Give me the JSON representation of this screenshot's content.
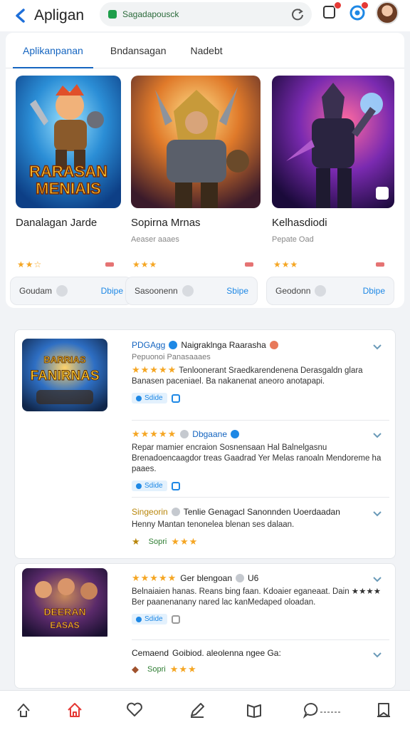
{
  "header": {
    "title": "Apligan",
    "url": "Sagadapousck"
  },
  "tabs": [
    {
      "label": "Aplikanpanan"
    },
    {
      "label": "Bndansagan"
    },
    {
      "label": "Nadebt"
    }
  ],
  "cards": [
    {
      "title": "Danalagan Jarde",
      "subtitle": "",
      "art_text_1": "RARASAN",
      "art_text_2": "MENIAIS",
      "stars": "★★☆",
      "foot_left": "Goudam",
      "foot_right": "Dbipe"
    },
    {
      "title": "Sopirna Mrnas",
      "subtitle": "Aeaser aaaes",
      "stars": "★★★",
      "foot_left": "Sasoonenn",
      "foot_right": "Sbipe"
    },
    {
      "title": "Kelhasdiodi",
      "subtitle": "Pepate Oad",
      "stars": "★★★",
      "foot_left": "Geodonn",
      "foot_right": "Dbipe"
    }
  ],
  "panel1": {
    "art_text_1": "BARRIAS",
    "art_text_2": "FANIRNAS",
    "rows": [
      {
        "title_a": "PDGAgg",
        "title_b": "Naigraklnga Raarasha",
        "sub": "Pepuonoi Panasaaaes",
        "stars": "★★★★★",
        "text": "Tenloonerant Sraedkarendenena Derasgaldn glara Banasen paceniael. Ba nakanenat aneoro anotapapi.",
        "chip": "Sdide"
      },
      {
        "title_a": "★★★★★",
        "title_b": "Dbgaane",
        "text": "Repar mamier encraion Sosnensaan Hal Balnelgasnu Brenadoencaagdor treas Gaadrad Yer Melas ranoaln Mendoreme ha paaes.",
        "chip": "Sdide"
      },
      {
        "title_a": "Singeorin",
        "title_b": "Tenlie Genagacl Sanonnden Uoerdaadan",
        "text": "Henny Mantan tenonelea blenan ses dalaan.",
        "foot": "Sopri",
        "stars": "★★★"
      }
    ]
  },
  "panel2": {
    "art_text_1": "DEERAN",
    "art_text_2": "EASAS",
    "rows": [
      {
        "title_a": "★★★★★",
        "title_b": "Ger blengoan",
        "title_c": "U6",
        "text": "Belnaiaien hanas. Reans bing faan. Kdoaier eganeaat. Dain ★★★★ Ber paanenanany nared lac kanMedaped oloadan.",
        "chip": "Sdide"
      },
      {
        "title_a": "Cemaend",
        "title_b": "Goibiod. aleolenna ngee Ga:",
        "foot": "Sopri",
        "stars": "★★★"
      }
    ]
  },
  "icons": {
    "back": "back-arrow-icon",
    "reload": "reload-icon",
    "tab_notify": "tabs-icon",
    "account": "account-icon",
    "nav": [
      "share-icon",
      "home-icon",
      "heart-icon",
      "edit-icon",
      "book-icon",
      "chat-icon",
      "bookmark-icon"
    ]
  },
  "colors": {
    "accent": "#1565c0",
    "star": "#f5a623",
    "badge": "#e53935"
  }
}
